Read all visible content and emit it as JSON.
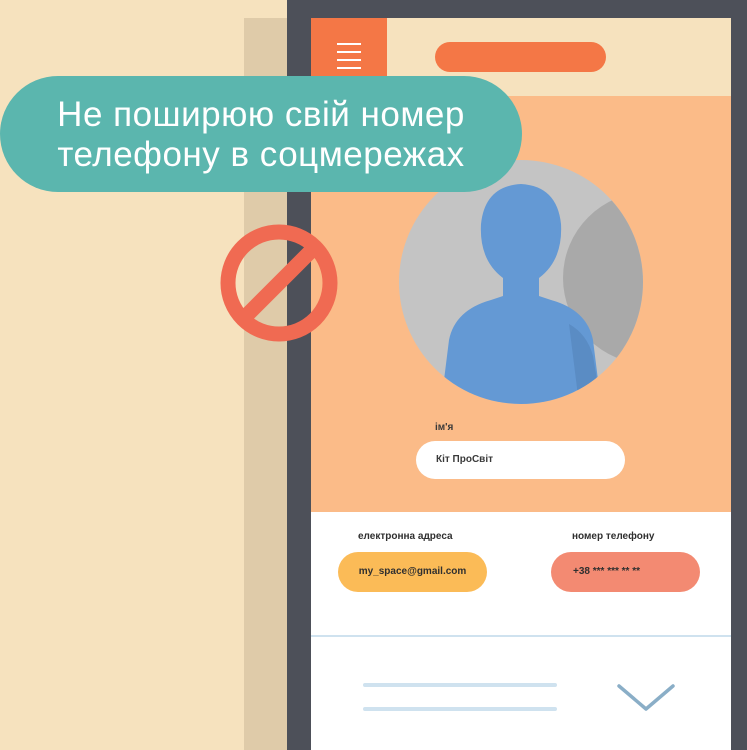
{
  "callout": {
    "line1": "Не поширюю свій номер",
    "line2": "телефону в соцмережах"
  },
  "app": {
    "menu_icon": "hamburger-menu-icon",
    "profile": {
      "avatar_icon": "user-silhouette-icon",
      "name_label": "ім'я",
      "name_value": "Кіт ПроСвіт"
    },
    "contacts": {
      "email_label": "електронна адреса",
      "email_value": "my_space@gmail.com",
      "phone_label": "номер телефону",
      "phone_value": "+38 *** *** ** **"
    },
    "expand_icon": "chevron-down-icon"
  },
  "prohibition_icon": "no-sign-icon",
  "colors": {
    "background": "#f6e2be",
    "frame": "#4d5059",
    "accent_orange": "#f47746",
    "profile_bg": "#fbbb88",
    "bubble": "#5bb6ae",
    "email_pill": "#fbbb57",
    "phone_pill": "#f38a72",
    "avatar_figure": "#6499d4",
    "no_sign": "#f06a52"
  }
}
